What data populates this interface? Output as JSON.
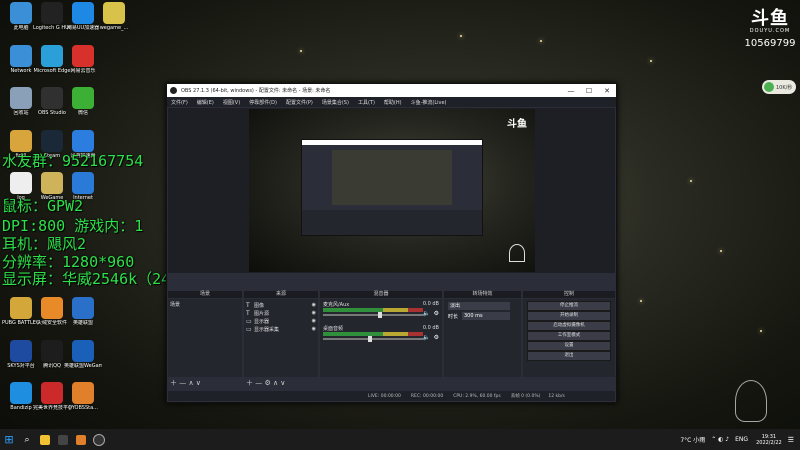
{
  "desktop_icons": [
    {
      "label": "此电脑",
      "color": "#3b8fd6"
    },
    {
      "label": "Logitech G HUB",
      "color": "#222"
    },
    {
      "label": "网易UU加速器",
      "color": "#1e88e5"
    },
    {
      "label": "wegame_...",
      "color": "#d9c24a"
    },
    {
      "label": "Network",
      "color": "#3b8fd6"
    },
    {
      "label": "Microsoft Edge",
      "color": "#2a9fd8"
    },
    {
      "label": "网易云音乐",
      "color": "#d8302b"
    },
    {
      "label": "回收站",
      "color": "#8aa0b8"
    },
    {
      "label": "OBS Studio",
      "color": "#303030"
    },
    {
      "label": "微信",
      "color": "#3cb034"
    },
    {
      "label": "fiddl",
      "color": "#d8a53c"
    },
    {
      "label": "Steam",
      "color": "#1b2838"
    },
    {
      "label": "迅游加速器",
      "color": "#2b7de0"
    },
    {
      "label": "log",
      "color": "#eee"
    },
    {
      "label": "WeGame",
      "color": "#cfb35a"
    },
    {
      "label": "Internet",
      "color": "#2a7bd8"
    },
    {
      "label": "PUBG BATTLEGR...",
      "color": "#d4a73a"
    },
    {
      "label": "火绒安全软件",
      "color": "#e88a28"
    },
    {
      "label": "英雄联盟",
      "color": "#2a6fc8"
    },
    {
      "label": "SKYS对平台",
      "color": "#1e4ba0"
    },
    {
      "label": "腾讯QQ",
      "color": "#1d1d1d"
    },
    {
      "label": "英雄联盟WeGame版",
      "color": "#1a5fb8"
    },
    {
      "label": "Bandizip",
      "color": "#1e8fe0"
    },
    {
      "label": "完美世界竞技平台",
      "color": "#cc2a2a"
    },
    {
      "label": "OYOBSSta...",
      "color": "#e0802a"
    }
  ],
  "overlay": {
    "line1": "水友群：952167754",
    "line2": "鼠标：GPW2",
    "line3": "DPI:800 游戏内：1",
    "line4": "耳机：飓风2",
    "line5": "分辨率：1280*960",
    "line6": "显示屏：华威2546k（240hz）"
  },
  "brand": {
    "logo": "斗鱼",
    "sub": "DOUYU.COM",
    "room": "10569799"
  },
  "net_widget": {
    "label": "10K/秒"
  },
  "obs": {
    "title": "OBS 27.1.3 (64-bit, windows) - 配置文件: 未命名 - 场景: 未命名",
    "menu": [
      "文件(F)",
      "编辑(E)",
      "视图(V)",
      "停靠部件(D)",
      "配置文件(P)",
      "场景集合(S)",
      "工具(T)",
      "帮助(H)",
      "斗鱼-推流(Live)"
    ],
    "preview_brand": "斗鱼",
    "docks": {
      "scenes": "场景",
      "sources": "来源",
      "mixer": "混音器",
      "transitions": "转场特效",
      "controls": "控制"
    },
    "scene_item": "场景",
    "sources": [
      "图像",
      "图片源",
      "显示器",
      "显示器采集"
    ],
    "mixer": [
      {
        "name": "麦克风/Aux",
        "db": "0.0 dB",
        "level": 0.55
      },
      {
        "name": "桌面音频",
        "db": "0.0 dB",
        "level": 0.45
      }
    ],
    "transition": {
      "type": "淡出",
      "duration_label": "时长",
      "duration": "300 ms"
    },
    "controls": [
      "停止推流",
      "开始录制",
      "启动虚拟摄像机",
      "工作室模式",
      "设置",
      "退出"
    ],
    "status": {
      "live": "LIVE: 00:00:00",
      "rec": "REC: 00:00:00",
      "cpu": "CPU: 2.9%, 60.00 fps",
      "dropped": "丢帧 0 (0.0%)",
      "kb": "12 kb/s"
    }
  },
  "taskbar": {
    "weather": "7°C 小雨",
    "lang": "ENG",
    "time": "19:31",
    "date": "2022/2/22"
  }
}
